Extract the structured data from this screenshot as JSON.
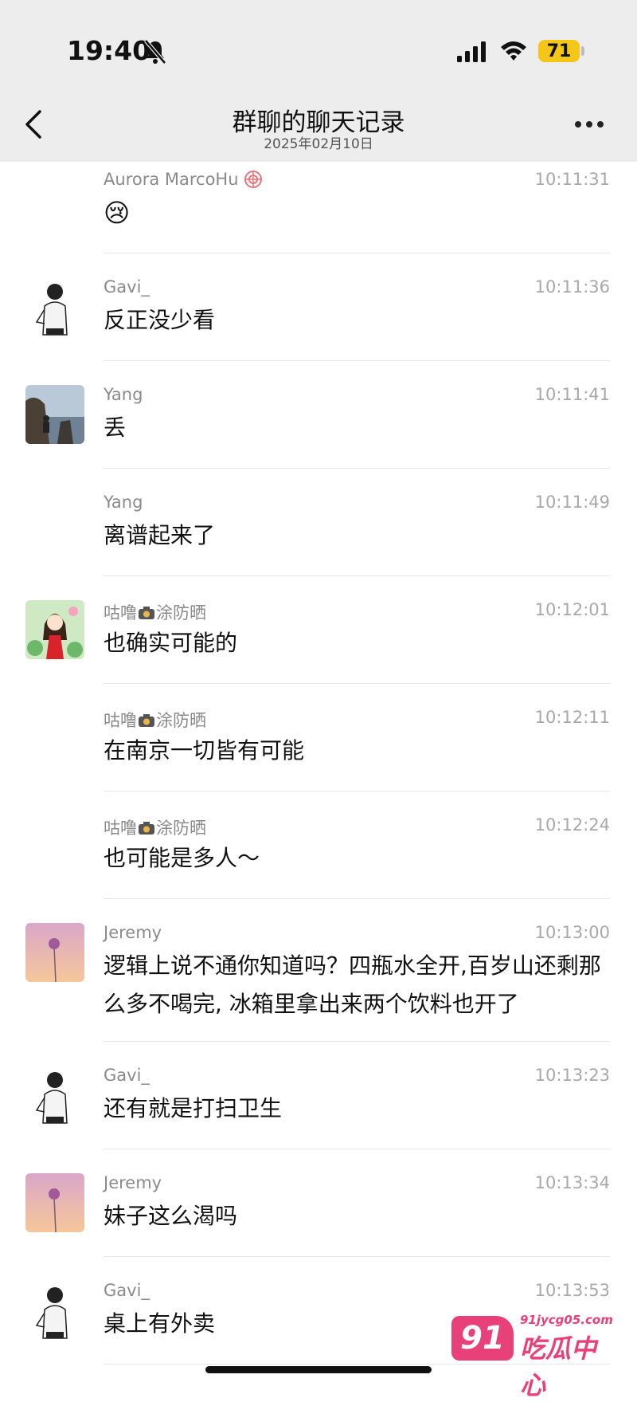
{
  "status_bar": {
    "time": "19:40",
    "battery": "71"
  },
  "nav": {
    "title": "群聊的聊天记录",
    "date": "2025年02月10日"
  },
  "messages": [
    {
      "sender": "Aurora MarcoHu",
      "time": "10:11:31",
      "text": "😢",
      "avatar": "none"
    },
    {
      "sender": "Gavi_",
      "time": "10:11:36",
      "text": "反正没少看",
      "avatar": "person-sketch"
    },
    {
      "sender": "Yang",
      "time": "10:11:41",
      "text": "丢",
      "avatar": "seaside-photo"
    },
    {
      "sender": "Yang",
      "time": "10:11:49",
      "text": "离谱起来了",
      "avatar": "none"
    },
    {
      "sender_pre": "咕噜",
      "sender_post": "涂防晒",
      "time": "10:12:01",
      "text": "也确实可能的",
      "avatar": "cartoon-girl"
    },
    {
      "sender_pre": "咕噜",
      "sender_post": "涂防晒",
      "time": "10:12:11",
      "text": "在南京一切皆有可能",
      "avatar": "none"
    },
    {
      "sender_pre": "咕噜",
      "sender_post": "涂防晒",
      "time": "10:12:24",
      "text": "也可能是多人～",
      "avatar": "none"
    },
    {
      "sender": "Jeremy",
      "time": "10:13:00",
      "text": "逻辑上说不通你知道吗？四瓶水全开,百岁山还剩那么多不喝完, 冰箱里拿出来两个饮料也开了",
      "avatar": "pink-flower"
    },
    {
      "sender": "Gavi_",
      "time": "10:13:23",
      "text": "还有就是打扫卫生",
      "avatar": "person-sketch"
    },
    {
      "sender": "Jeremy",
      "time": "10:13:34",
      "text": "妹子这么渴吗",
      "avatar": "pink-flower"
    },
    {
      "sender": "Gavi_",
      "time": "10:13:53",
      "text": "桌上有外卖",
      "avatar": "person-sketch"
    }
  ],
  "watermark": {
    "number": "91",
    "url": "91jycg05.com",
    "name": "吃瓜中心"
  },
  "colors": {
    "header_bg": "#ededed",
    "battery": "#f4c617",
    "watermark": "#e8417a"
  }
}
